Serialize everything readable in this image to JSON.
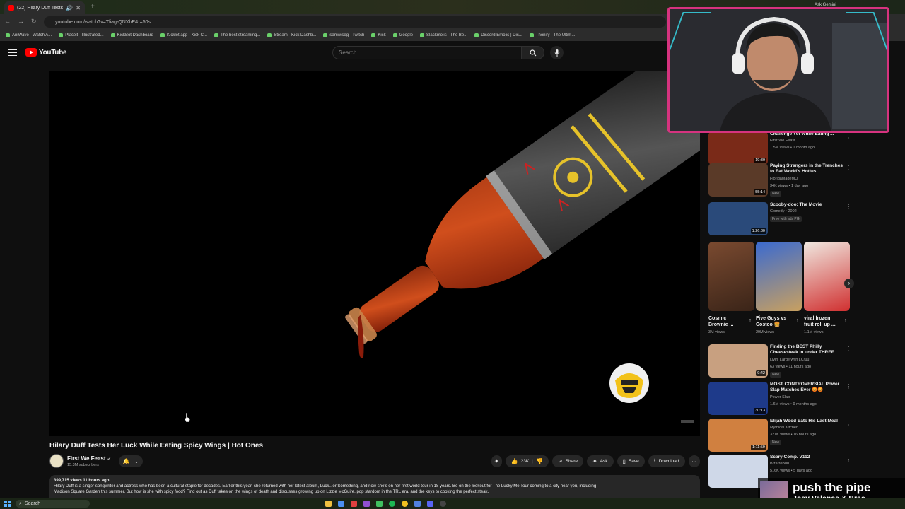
{
  "browser": {
    "tab_title": "(22) Hilary Duff Tests Her L...",
    "url": "youtube.com/watch?v=Tliag-QNXbE&t=50s",
    "bookmarks": [
      "AniWave - Watch A...",
      "Placeit - Illustrated...",
      "KickBot Dashboard",
      "Kicklet.app - Kick C...",
      "The best streaming...",
      "Stream - Kick Dashb...",
      "samwiseg - Twitch",
      "Kick",
      "Google",
      "Slackmojis - The Be...",
      "Discord Emojis | Dis...",
      "Thonify - The Ultim..."
    ],
    "ask_label": "Ask Gemini"
  },
  "header": {
    "logo_text": "YouTube",
    "search_placeholder": "Search"
  },
  "video": {
    "title": "Hilary Duff Tests Her Luck While Eating Spicy Wings | Hot Ones",
    "channel": "First We Feast",
    "subscribers": "15.3M subscribers",
    "likes": "23K",
    "share": "Share",
    "ask": "Ask",
    "save": "Save",
    "download": "Download",
    "stats": "399,715 views  11 hours ago",
    "description_1": "Hilary Duff is a singer-songwriter and actress who has been a cultural staple for decades. Earlier this year, she returned with her latest album, Luck...or Something, and now she's on her first world tour in 18 years. Be on the lookout for The Lucky Me Tour coming to a city near you, including",
    "description_2": "Madison Square Garden this summer. But how is she with spicy food? Find out as Duff takes on the wings of death and discusses growing up on Lizzie McGuire, pop stardom in the TRL era, and the keys to cooking the perfect steak."
  },
  "recommendations": [
    {
      "title": "Challenge Yet While Eating ...",
      "channel": "First We Feast",
      "meta": "1.5M views • 1 month ago",
      "duration": "19:39",
      "badge": ""
    },
    {
      "title": "Paying Strangers in the Trenches to Eat World's Hottes...",
      "channel": "FloridaMadeMO",
      "meta": "34K views • 1 day ago",
      "duration": "55:14",
      "badge": "New"
    },
    {
      "title": "Scooby-doo: The Movie",
      "channel": "Comedy • 2002",
      "meta": "",
      "duration": "1:26:30",
      "badge": "Free with ads  PG"
    },
    {
      "title": "Finding the BEST Philly Cheesesteak in under THREE ...",
      "channel": "Livin' Large with LC!uu",
      "meta": "63 views • 11 hours ago",
      "duration": "9:42",
      "badge": "New"
    },
    {
      "title": "MOST CONTROVERSIAL Power Slap Matches Ever 😡😡",
      "channel": "Power Slap",
      "meta": "1.6M views • 9 months ago",
      "duration": "30:13",
      "badge": ""
    },
    {
      "title": "Elijah Wood Eats His Last Meal",
      "channel": "Mythical Kitchen",
      "meta": "321K views • 16 hours ago",
      "duration": "1:11:59",
      "badge": "New"
    },
    {
      "title": "Scary Comp. V112",
      "channel": "BizarreBub",
      "meta": "516K views • 5 days ago",
      "duration": "",
      "badge": ""
    }
  ],
  "shorts": [
    {
      "title": "Cosmic Brownie ...",
      "views": "3M views"
    },
    {
      "title": "Five Guys vs Costco 🍔",
      "views": "29M views"
    },
    {
      "title": "viral frozen fruit roll up ...",
      "views": "1.1M views"
    }
  ],
  "now_playing": {
    "song": "push the pipe",
    "artist": "Joey Valence & Brae",
    "progress": 0.3
  },
  "taskbar": {
    "search": "Search"
  }
}
